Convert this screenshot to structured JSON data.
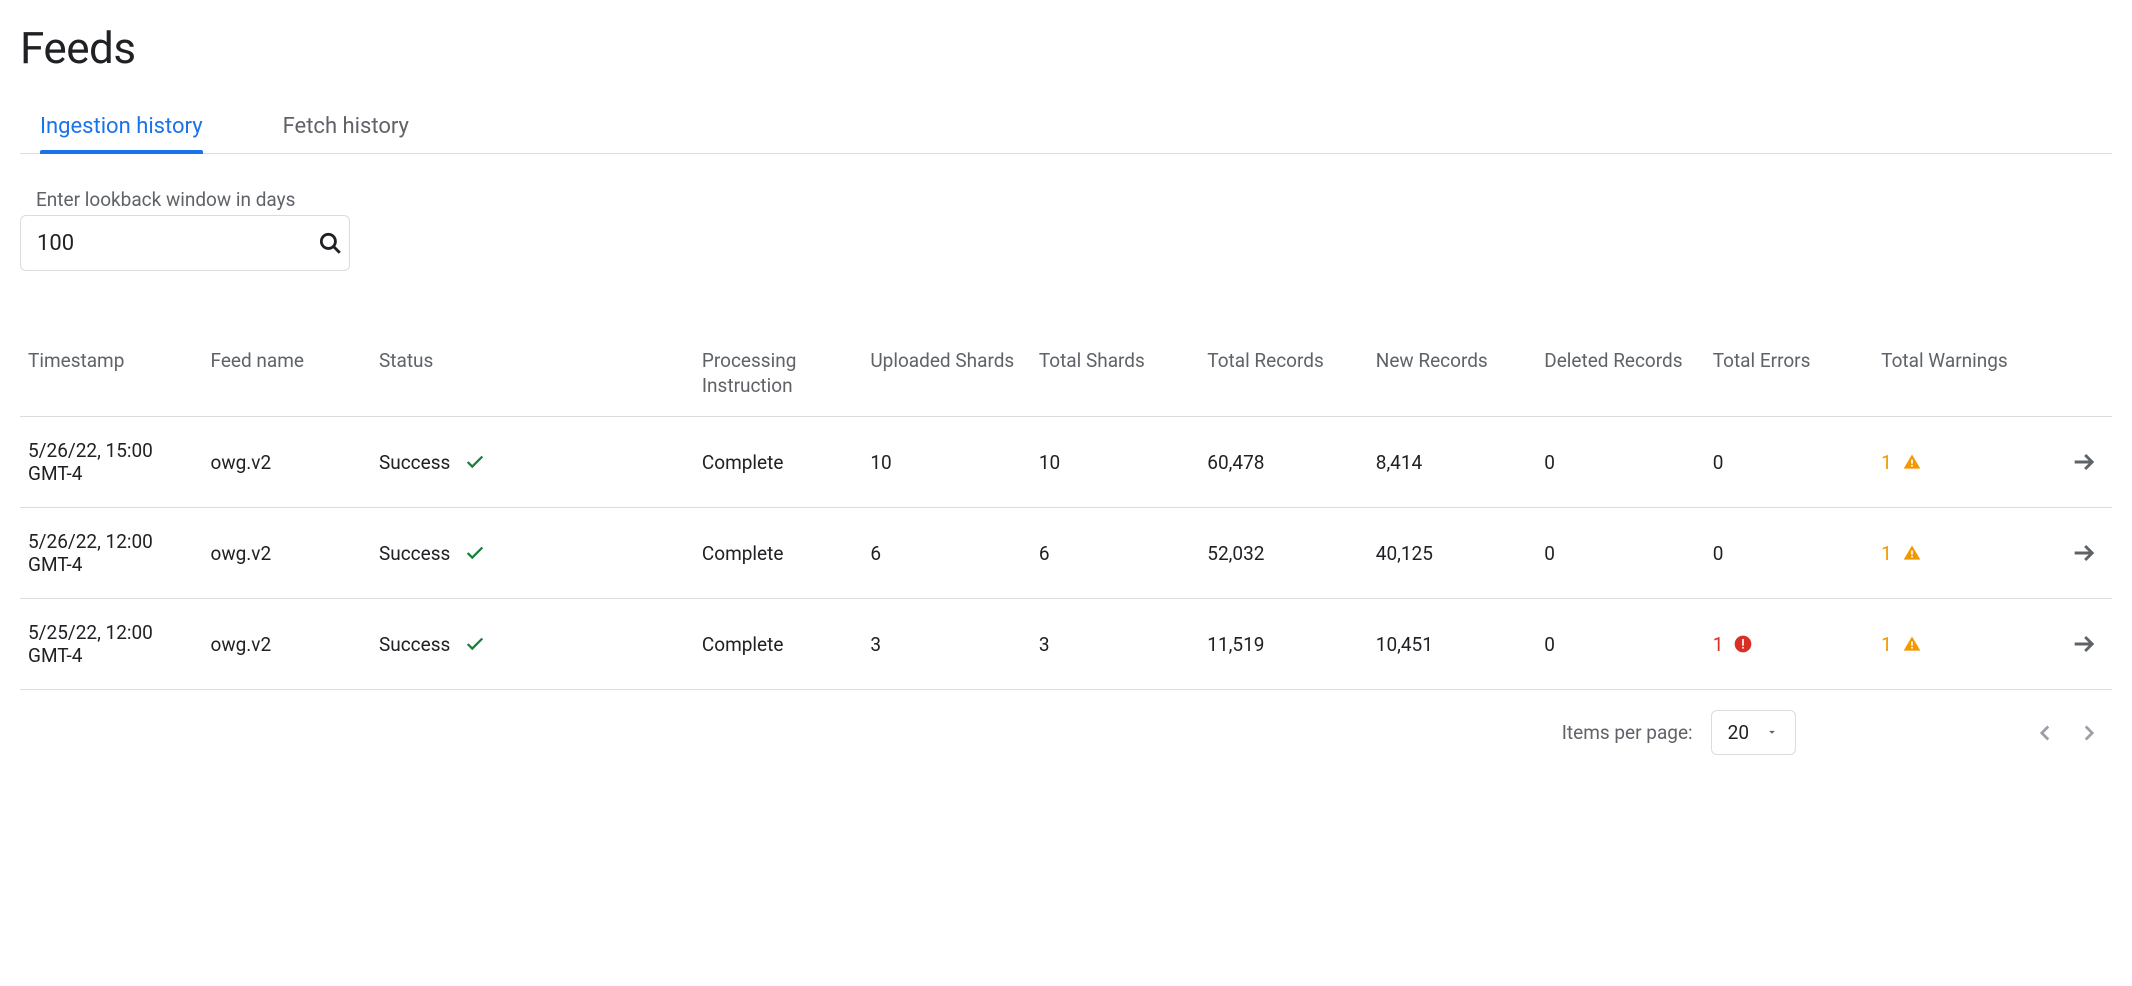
{
  "page": {
    "title": "Feeds"
  },
  "tabs": [
    {
      "label": "Ingestion history",
      "active": true
    },
    {
      "label": "Fetch history",
      "active": false
    }
  ],
  "lookback": {
    "label": "Enter lookback window in days",
    "value": "100"
  },
  "columns": {
    "timestamp": "Timestamp",
    "feed_name": "Feed name",
    "status": "Status",
    "processing_instruction": "Processing Instruction",
    "uploaded_shards": "Uploaded Shards",
    "total_shards": "Total Shards",
    "total_records": "Total Records",
    "new_records": "New Records",
    "deleted_records": "Deleted Records",
    "total_errors": "Total Errors",
    "total_warnings": "Total Warnings"
  },
  "rows": [
    {
      "timestamp": "5/26/22, 15:00 GMT-4",
      "feed_name": "owg.v2",
      "status": "Success",
      "processing_instruction": "Complete",
      "uploaded_shards": "10",
      "total_shards": "10",
      "total_records": "60,478",
      "new_records": "8,414",
      "deleted_records": "0",
      "total_errors": "0",
      "errors_flag": false,
      "total_warnings": "1",
      "warnings_flag": true
    },
    {
      "timestamp": "5/26/22, 12:00 GMT-4",
      "feed_name": "owg.v2",
      "status": "Success",
      "processing_instruction": "Complete",
      "uploaded_shards": "6",
      "total_shards": "6",
      "total_records": "52,032",
      "new_records": "40,125",
      "deleted_records": "0",
      "total_errors": "0",
      "errors_flag": false,
      "total_warnings": "1",
      "warnings_flag": true
    },
    {
      "timestamp": "5/25/22, 12:00 GMT-4",
      "feed_name": "owg.v2",
      "status": "Success",
      "processing_instruction": "Complete",
      "uploaded_shards": "3",
      "total_shards": "3",
      "total_records": "11,519",
      "new_records": "10,451",
      "deleted_records": "0",
      "total_errors": "1",
      "errors_flag": true,
      "total_warnings": "1",
      "warnings_flag": true
    }
  ],
  "pagination": {
    "label": "Items per page:",
    "page_size": "20"
  }
}
